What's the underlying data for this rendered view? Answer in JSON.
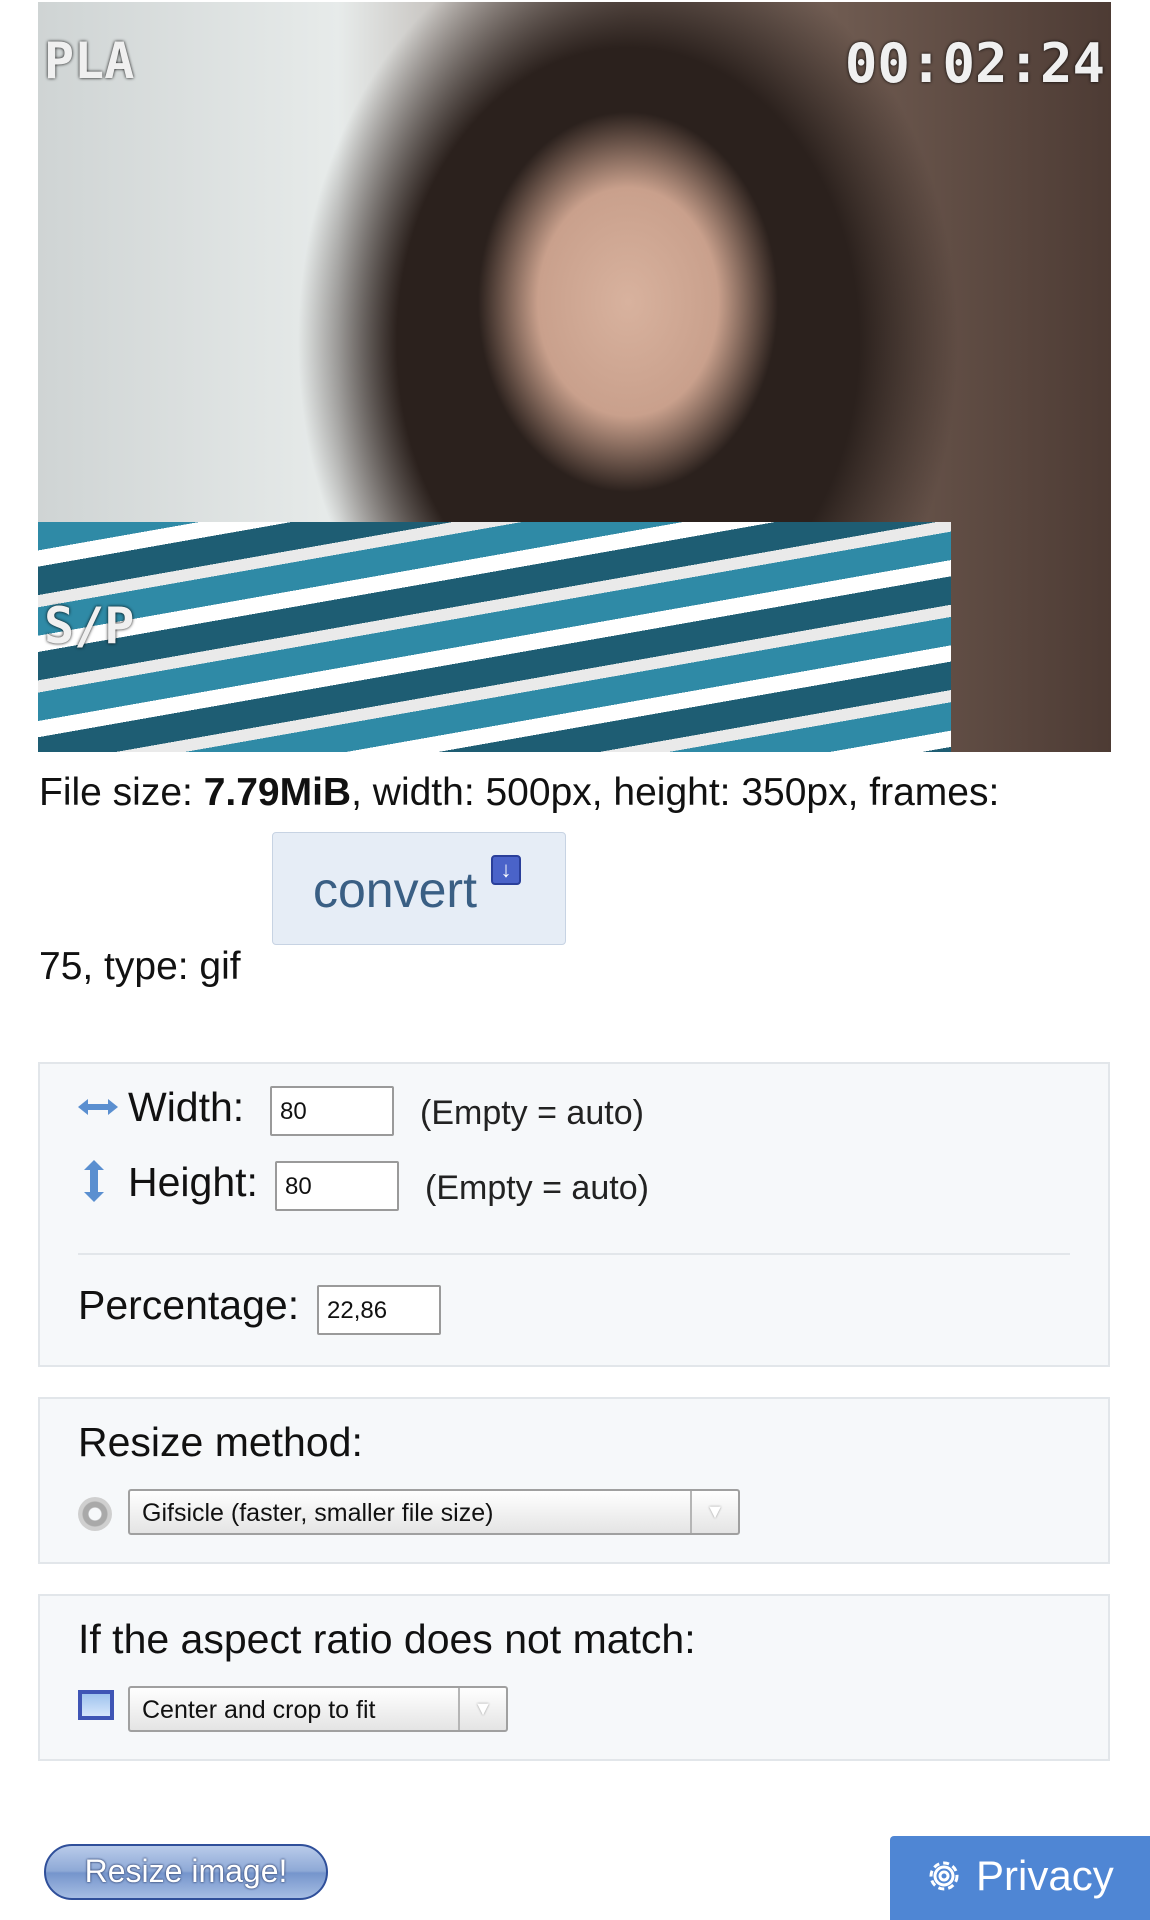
{
  "preview": {
    "osd_top_left": "PLA",
    "osd_bottom_left": "S/P",
    "osd_timecode": "00:02:24"
  },
  "file_info": {
    "size_prefix": "File size: ",
    "size_value": "7.79MiB",
    "rest_line1": ", width: 500px, height: 350px, frames:",
    "line2": "75, type: gif"
  },
  "convert_button": {
    "label": "convert"
  },
  "dimensions": {
    "width_label": "Width:",
    "width_value": "80",
    "width_hint": "(Empty = auto)",
    "height_label": "Height:",
    "height_value": "80",
    "height_hint": "(Empty = auto)",
    "percentage_label": "Percentage:",
    "percentage_value": "22,86"
  },
  "resize_method": {
    "label": "Resize method:",
    "selected": "Gifsicle (faster, smaller file size)"
  },
  "aspect_ratio": {
    "label": "If the aspect ratio does not match:",
    "selected": "Center and crop to fit"
  },
  "actions": {
    "resize_label": "Resize image!",
    "privacy_label": "Privacy"
  }
}
